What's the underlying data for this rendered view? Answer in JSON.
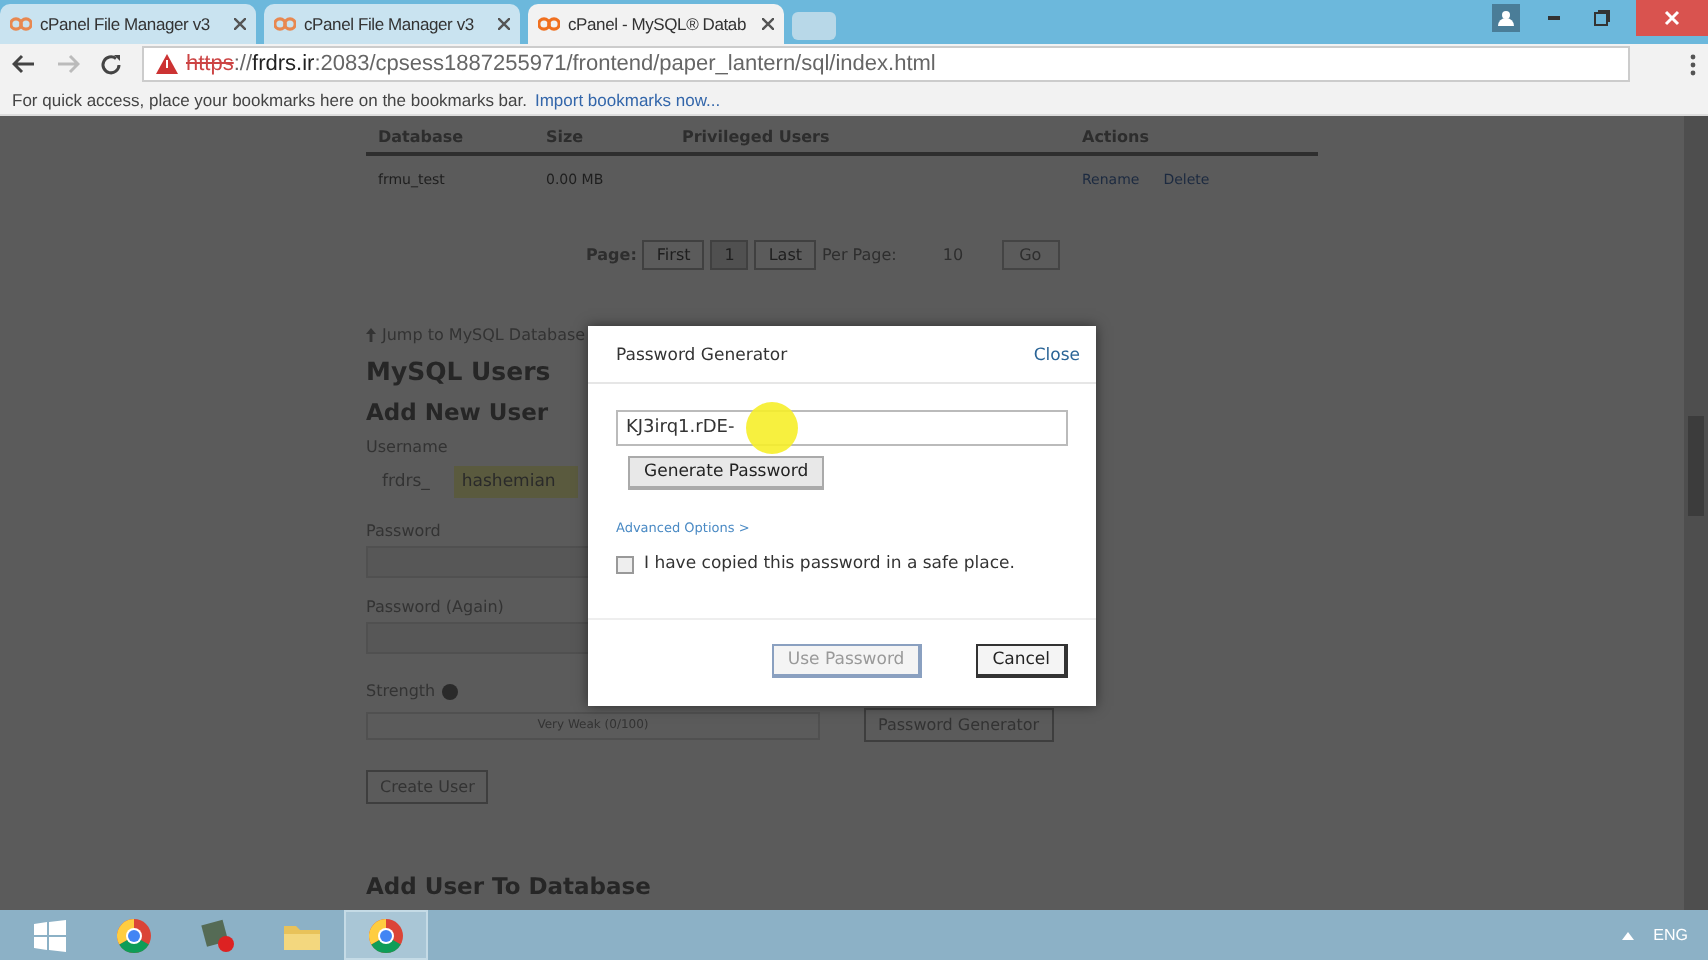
{
  "browser": {
    "tabs": [
      {
        "title": "cPanel File Manager v3",
        "selected": false
      },
      {
        "title": "cPanel File Manager v3",
        "selected": false
      },
      {
        "title": "cPanel - MySQL® Datab",
        "selected": true
      }
    ],
    "address": {
      "insecure": true,
      "scheme": "https",
      "separator": "://",
      "host": "frdrs.ir",
      "rest": ":2083/cpsess1887255971/frontend/paper_lantern/sql/index.html"
    },
    "bookmarks_bar": {
      "message": "For quick access, place your bookmarks here on the bookmarks bar.",
      "link": "Import bookmarks now..."
    }
  },
  "page": {
    "table": {
      "columns": [
        "Database",
        "Size",
        "Privileged Users",
        "Actions"
      ],
      "rows": [
        {
          "database": "frmu_test",
          "size": "0.00 MB",
          "actions": [
            "Rename",
            "Delete"
          ]
        }
      ]
    },
    "pagination": {
      "label": "Page:",
      "buttons": [
        "First",
        "1",
        "Last"
      ],
      "per_page_label": "Per Page:",
      "per_page": "10",
      "go": "Go"
    },
    "jump_link": "Jump to MySQL Database",
    "section_title": "MySQL Users",
    "form": {
      "title": "Add New User",
      "username_label": "Username",
      "prefix": "frdrs_",
      "username": "hashemian",
      "password_label": "Password",
      "password_again_label": "Password (Again)",
      "strength_label": "Strength",
      "strength_text": "Very Weak (0/100)",
      "generator_button": "Password Generator",
      "create_button": "Create User"
    },
    "next_section_title": "Add User To Database"
  },
  "dialog": {
    "title": "Password Generator",
    "close": "Close",
    "password": "KJ3irq1.rDE-",
    "generate_button": "Generate Password",
    "advanced_link": "Advanced Options >",
    "confirm": {
      "label": "I have copied this password in a safe place.",
      "checked": false
    },
    "buttons": [
      {
        "label": "Use Password",
        "disabled": true
      },
      {
        "label": "Cancel",
        "disabled": false
      }
    ]
  },
  "taskbar": {
    "apps": [
      {
        "kind": "chrome",
        "selected": false
      },
      {
        "kind": "tool",
        "selected": false
      },
      {
        "kind": "folder",
        "selected": false
      },
      {
        "kind": "chrome",
        "selected": true
      }
    ],
    "language": "ENG"
  }
}
